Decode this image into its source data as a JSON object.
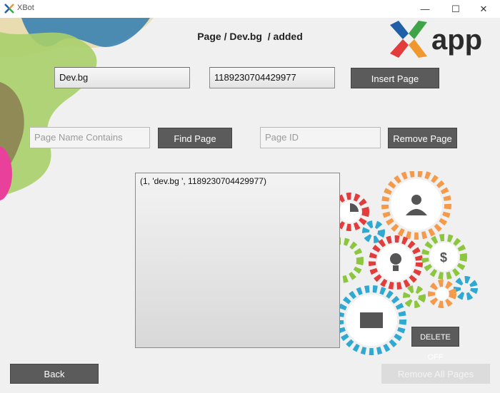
{
  "window": {
    "title": "XBot",
    "minimize": "—",
    "maximize": "☐",
    "close": "✕"
  },
  "header": {
    "status": "Page / Dev.bg  / added",
    "logo_text": "app"
  },
  "insert": {
    "name_value": "Dev.bg",
    "id_value": "1189230704429977",
    "button": "Insert Page"
  },
  "find": {
    "placeholder": "Page Name Contains",
    "button": "Find Page"
  },
  "remove": {
    "placeholder": "Page ID",
    "button": "Remove Page"
  },
  "results": {
    "rows": [
      "(1, 'dev.bg ', 1189230704429977)"
    ]
  },
  "actions": {
    "delete_off": "DELETE OFF",
    "back": "Back",
    "remove_all": "Remove All Pages"
  },
  "colors": {
    "button_bg": "#5b5b5b",
    "logo_blue": "#1e5fa8",
    "logo_green": "#3fa447",
    "logo_orange": "#f0972e",
    "logo_red": "#e23c3c"
  }
}
